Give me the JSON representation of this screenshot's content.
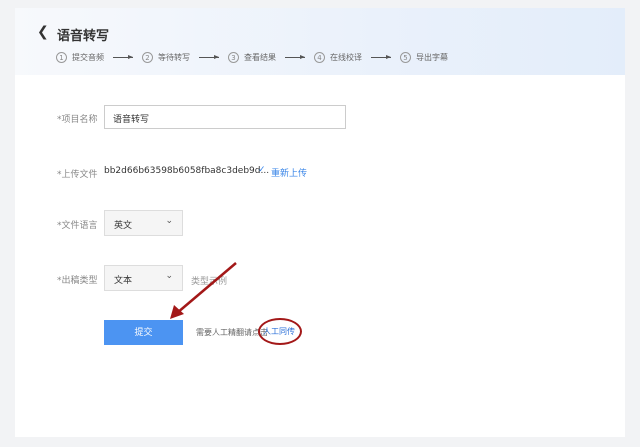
{
  "header": {
    "title": "语音转写",
    "steps": [
      {
        "num": "1",
        "label": "提交音频"
      },
      {
        "num": "2",
        "label": "等待转写"
      },
      {
        "num": "3",
        "label": "查看结果"
      },
      {
        "num": "4",
        "label": "在线校译"
      },
      {
        "num": "5",
        "label": "导出字幕"
      }
    ]
  },
  "form": {
    "project_name_label": "*项目名称",
    "project_name_value": "语音转写",
    "upload_label": "*上传文件",
    "upload_file": "bb2d66b63598b6058fba8c3deb9d...",
    "reupload": "重新上传",
    "language_label": "*文件语言",
    "language_value": "英文",
    "output_type_label": "*出稿类型",
    "output_type_value": "文本",
    "type_example": "类型示例",
    "submit": "提交",
    "hint": "需要人工精翻请点击",
    "human_link": "人工同传"
  },
  "annotation_color": "#a31818"
}
